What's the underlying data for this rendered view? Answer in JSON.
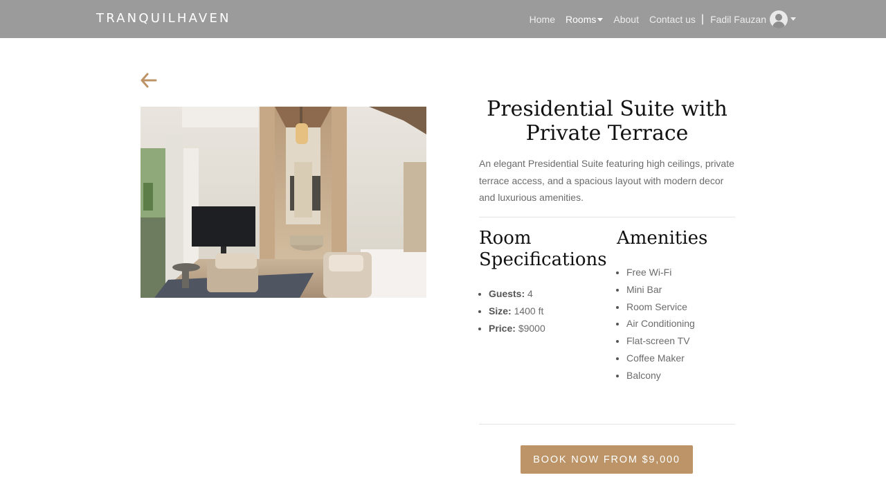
{
  "brand": "TRANQUILHAVEN",
  "nav": {
    "home": "Home",
    "rooms": "Rooms",
    "about": "About",
    "contact": "Contact us",
    "separator": "|",
    "user_name": "Fadil Fauzan"
  },
  "room": {
    "title": "Presidential Suite with Private Terrace",
    "description": "An elegant Presidential Suite featuring high ceilings, private terrace access, and a spacious layout with modern decor and luxurious amenities.",
    "specs_heading": "Room Specifications",
    "specs": [
      {
        "label": "Guests:",
        "value": "4"
      },
      {
        "label": "Size:",
        "value": "1400 ft"
      },
      {
        "label": "Price:",
        "value": "$9000"
      }
    ],
    "amenities_heading": "Amenities",
    "amenities": [
      "Free Wi-Fi",
      "Mini Bar",
      "Room Service",
      "Air Conditioning",
      "Flat-screen TV",
      "Coffee Maker",
      "Balcony"
    ],
    "book_label": "BOOK NOW FROM $9,000"
  },
  "colors": {
    "navbar_bg": "#9b9b9b",
    "accent": "#bd9467"
  },
  "icons": {
    "back": "arrow-left-icon",
    "avatar": "user-avatar-icon",
    "dropdown": "caret-down-icon"
  }
}
